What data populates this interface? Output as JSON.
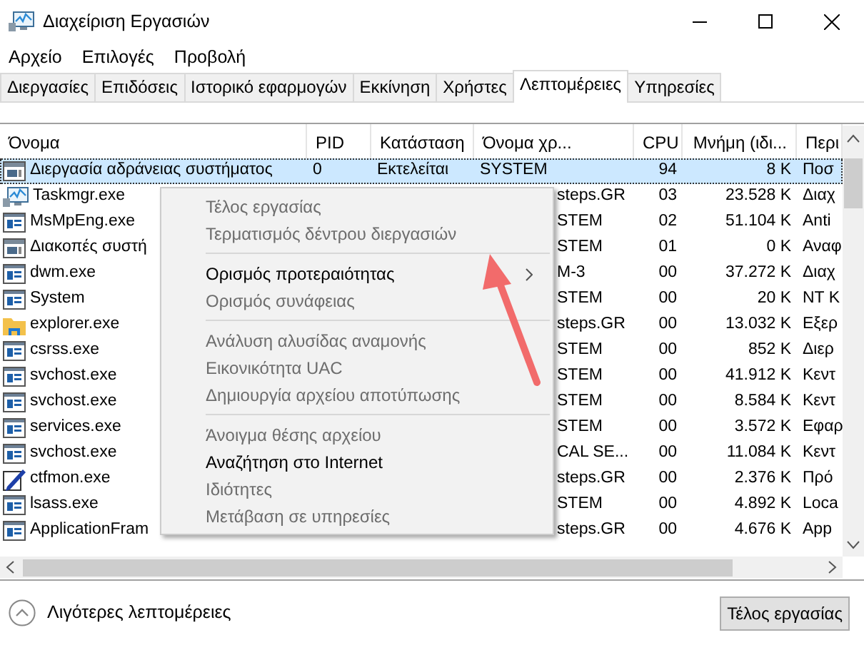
{
  "window": {
    "title": "Διαχείριση Εργασιών"
  },
  "menu": [
    "Αρχείο",
    "Επιλογές",
    "Προβολή"
  ],
  "tabs": [
    {
      "label": "Διεργασίες",
      "selected": false
    },
    {
      "label": "Επιδόσεις",
      "selected": false
    },
    {
      "label": "Ιστορικό εφαρμογών",
      "selected": false
    },
    {
      "label": "Εκκίνηση",
      "selected": false
    },
    {
      "label": "Χρήστες",
      "selected": false
    },
    {
      "label": "Λεπτομέρειες",
      "selected": true
    },
    {
      "label": "Υπηρεσίες",
      "selected": false
    }
  ],
  "table": {
    "columns": [
      "Όνομα",
      "PID",
      "Κατάσταση",
      "Όνομα χρ...",
      "CPU",
      "Μνήμη (ιδι...",
      "Περι"
    ],
    "rows": [
      {
        "kind": "system",
        "name": "Διεργασία αδράνειας συστήματος",
        "pid": "0",
        "status": "Εκτελείται",
        "user": "SYSTEM",
        "cpu": "94",
        "memory": "8 K",
        "description": "Ποσ",
        "selected": true
      },
      {
        "kind": "monitor",
        "name": "Taskmgr.exe",
        "user": "steps.GR",
        "cpu": "03",
        "memory": "23.528 K",
        "description": "Διαχ",
        "selected": false
      },
      {
        "kind": "app",
        "name": "MsMpEng.exe",
        "user": "STEM",
        "cpu": "02",
        "memory": "51.104 K",
        "description": "Anti",
        "selected": false
      },
      {
        "kind": "system",
        "name": "Διακοπές συστή",
        "user": "STEM",
        "cpu": "01",
        "memory": "0 K",
        "description": "Αναφ",
        "selected": false
      },
      {
        "kind": "app",
        "name": "dwm.exe",
        "user": "M-3",
        "cpu": "00",
        "memory": "37.272 K",
        "description": "Διαχ",
        "selected": false
      },
      {
        "kind": "app",
        "name": "System",
        "user": "STEM",
        "cpu": "00",
        "memory": "20 K",
        "description": "NT K",
        "selected": false
      },
      {
        "kind": "folder",
        "name": "explorer.exe",
        "user": "steps.GR",
        "cpu": "00",
        "memory": "13.032 K",
        "description": "Εξερ",
        "selected": false
      },
      {
        "kind": "app",
        "name": "csrss.exe",
        "user": "STEM",
        "cpu": "00",
        "memory": "852 K",
        "description": "Διερ",
        "selected": false
      },
      {
        "kind": "app",
        "name": "svchost.exe",
        "user": "STEM",
        "cpu": "00",
        "memory": "41.912 K",
        "description": "Κεντ",
        "selected": false
      },
      {
        "kind": "app",
        "name": "svchost.exe",
        "user": "STEM",
        "cpu": "00",
        "memory": "8.584 K",
        "description": "Κεντ",
        "selected": false
      },
      {
        "kind": "app",
        "name": "services.exe",
        "user": "STEM",
        "cpu": "00",
        "memory": "3.572 K",
        "description": "Εφαρ",
        "selected": false
      },
      {
        "kind": "app",
        "name": "svchost.exe",
        "user": "CAL SE...",
        "cpu": "00",
        "memory": "11.084 K",
        "description": "Κεντ",
        "selected": false
      },
      {
        "kind": "pen",
        "name": "ctfmon.exe",
        "user": "steps.GR",
        "cpu": "00",
        "memory": "2.376 K",
        "description": "Πρό",
        "selected": false
      },
      {
        "kind": "app",
        "name": "lsass.exe",
        "user": "STEM",
        "cpu": "00",
        "memory": "4.892 K",
        "description": "Loca",
        "selected": false
      },
      {
        "kind": "app",
        "name": "ApplicationFram",
        "user": "steps.GR",
        "cpu": "00",
        "memory": "4.676 K",
        "description": "App",
        "selected": false
      }
    ]
  },
  "context_menu": [
    {
      "kind": "item",
      "label": "Τέλος εργασίας",
      "disabled": true
    },
    {
      "kind": "item",
      "label": "Τερματισμός δέντρου διεργασιών",
      "disabled": true
    },
    {
      "kind": "separator"
    },
    {
      "kind": "item",
      "label": "Ορισμός προτεραιότητας",
      "disabled": false,
      "submenu": true
    },
    {
      "kind": "item",
      "label": "Ορισμός συνάφειας",
      "disabled": true
    },
    {
      "kind": "separator"
    },
    {
      "kind": "item",
      "label": "Ανάλυση αλυσίδας αναμονής",
      "disabled": true
    },
    {
      "kind": "item",
      "label": "Εικονικότητα UAC",
      "disabled": true
    },
    {
      "kind": "item",
      "label": "Δημιουργία αρχείου αποτύπωσης",
      "disabled": true
    },
    {
      "kind": "separator"
    },
    {
      "kind": "item",
      "label": "Άνοιγμα θέσης αρχείου",
      "disabled": true
    },
    {
      "kind": "item",
      "label": "Αναζήτηση στο Internet",
      "disabled": false
    },
    {
      "kind": "item",
      "label": "Ιδιότητες",
      "disabled": true
    },
    {
      "kind": "item",
      "label": "Μετάβαση σε υπηρεσίες",
      "disabled": true
    }
  ],
  "footer": {
    "details_link": "Λιγότερες λεπτομέρειες",
    "end_task_button": "Τέλος εργασίας"
  }
}
